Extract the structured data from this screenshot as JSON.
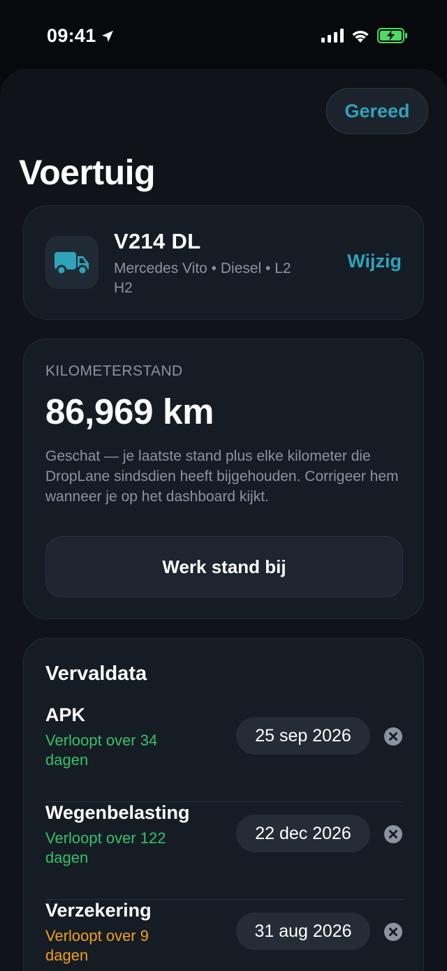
{
  "status_bar": {
    "time": "09:41",
    "icons": [
      "location-arrow-icon",
      "signal-icon",
      "wifi-icon",
      "battery-charging-icon"
    ],
    "battery_color": "#4cd964"
  },
  "header": {
    "done_label": "Gereed",
    "title": "Voertuig"
  },
  "vehicle": {
    "plate": "V214 DL",
    "description": "Mercedes Vito • Diesel • L2 H2",
    "edit_label": "Wijzig",
    "icon": "truck-icon"
  },
  "odometer": {
    "label": "KILOMETERSTAND",
    "value": "86,969 km",
    "note": "Geschat — je laatste stand plus elke kilometer die DropLane sindsdien heeft bijgehouden. Corrigeer hem wanneer je op het dashboard kijkt.",
    "update_label": "Werk stand bij"
  },
  "due_dates": {
    "title": "Vervaldata",
    "items": [
      {
        "name": "APK",
        "status": "Verloopt over 34 dagen",
        "date": "25 sep 2026",
        "status_color": "#34c26b"
      },
      {
        "name": "Wegenbelasting",
        "status": "Verloopt over 122 dagen",
        "date": "22 dec 2026",
        "status_color": "#34c26b"
      },
      {
        "name": "Verzekering",
        "status": "Verloopt over 9 dagen",
        "date": "31 aug 2026",
        "status_color": "#f0a020"
      }
    ]
  },
  "colors": {
    "accent": "#2fa3ba",
    "ok": "#34c26b",
    "warning": "#f0a020"
  }
}
